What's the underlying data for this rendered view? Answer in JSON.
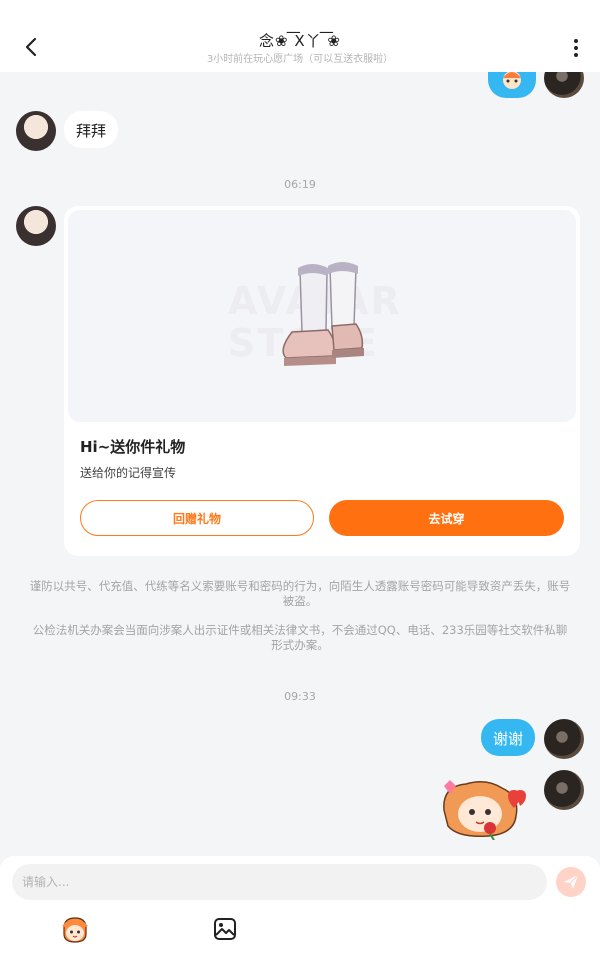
{
  "header": {
    "title": "念❀ ͞X丫 ͞❀",
    "subtitle": "3小时前在玩心愿广场（可以互送衣服啦）"
  },
  "messages": {
    "bye_text": "拜拜",
    "time_1": "06:19",
    "gift_card": {
      "watermark": "AVATAR STORE",
      "title": "Hi~送你件礼物",
      "description": "送给你的记得宣传",
      "return_gift_label": "回赠礼物",
      "try_on_label": "去试穿"
    },
    "notice_1": "谨防以共号、代充值、代练等名义索要账号和密码的行为，向陌生人透露账号密码可能导致资产丢失，账号被盗。",
    "notice_2": "公检法机关办案会当面向涉案人出示证件或相关法律文书，不会通过QQ、电话、233乐园等社交软件私聊形式办案。",
    "time_2": "09:33",
    "thanks_text": "谢谢"
  },
  "input": {
    "placeholder": "请输入..."
  },
  "colors": {
    "accent_orange": "#ff7010",
    "bubble_blue": "#35b8f2",
    "send_disabled": "#ffd3c7"
  },
  "icons": {
    "back": "chevron-left-icon",
    "more": "more-vertical-icon",
    "send": "send-icon",
    "emoji": "emoji-icon",
    "image": "image-icon"
  }
}
